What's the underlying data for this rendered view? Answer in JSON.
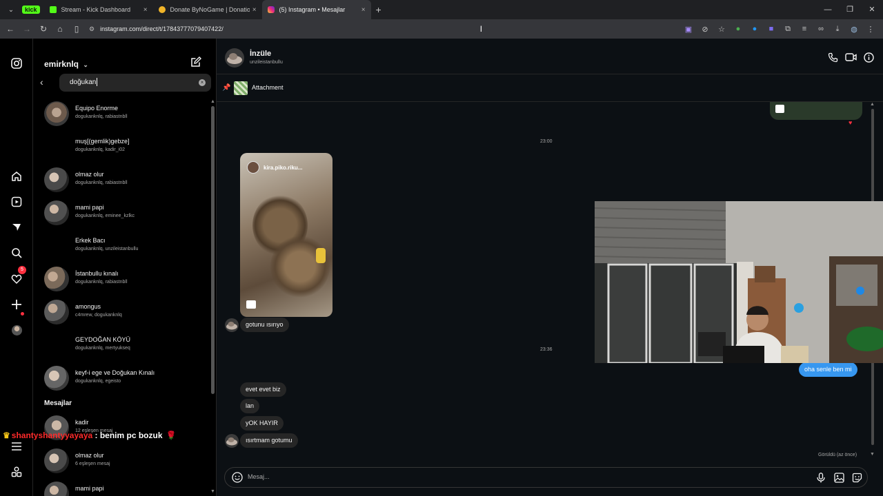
{
  "browser": {
    "kick_badge": "kick",
    "tabs": [
      {
        "title": "Stream - Kick Dashboard",
        "close": "×"
      },
      {
        "title": "Donate ByNoGame | Donations",
        "close": "×"
      },
      {
        "title": "(5) Instagram • Mesajlar",
        "close": "×"
      }
    ],
    "url": "instagram.com/direct/t/17843777079407422/"
  },
  "sidebar": {
    "notification_count": "5"
  },
  "conversations": {
    "account_name": "emirknlq",
    "search_value": "doğukan",
    "results": [
      {
        "name": "Equipo Enorme",
        "members": "dogukanknlq, rabiastnbll"
      },
      {
        "name": "muş[(gemlik)gebze]",
        "members": "dogukanknlq, kadir_i02"
      },
      {
        "name": "olmaz olur",
        "members": "dogukanknlq, rabiastnbll"
      },
      {
        "name": "mami papi",
        "members": "dogukanknlq, eminee_kzlkc"
      },
      {
        "name": "Erkek Bacı",
        "members": "dogukanknlq, unzileistanbullu"
      },
      {
        "name": "İstanbullu kınalı",
        "members": "dogukanknlq, rabiastnbll"
      },
      {
        "name": "amongus",
        "members": "c4mrew, dogukanknlq"
      },
      {
        "name": "GEYDOĞAN KÖYÜ",
        "members": "dogukanknlq, mertyukseq"
      },
      {
        "name": "keyf-i ege ve Doğukan Kınalı",
        "members": "dogukanknlq, egeisto"
      }
    ],
    "messages_title": "Mesajlar",
    "message_results": [
      {
        "name": "kadir",
        "members": "12 eşleşen mesaj"
      },
      {
        "name": "olmaz olur",
        "members": "6 eşleşen mesaj"
      },
      {
        "name": "mami papi",
        "members": ""
      }
    ]
  },
  "stream_chat": {
    "user": "shantyshantyyayaya",
    "separator": " : ",
    "message": "benim pc bozuk"
  },
  "thread": {
    "name": "İnzüle",
    "username": "unzileistanbullu",
    "pinned_label": "Attachment",
    "timestamps": [
      "23:00",
      "23:36"
    ],
    "reel_user": "kira.piko.riku...",
    "messages_theirs_1": [
      "gotunu ısırıyo"
    ],
    "message_mine": "oha senle ben mi",
    "messages_theirs_2": [
      "evet evet biz",
      "lan",
      "yOK HAYIR",
      "ısırtmam gotumu"
    ],
    "seen": "Görüldü (az önce)",
    "composer_placeholder": "Mesaj..."
  }
}
